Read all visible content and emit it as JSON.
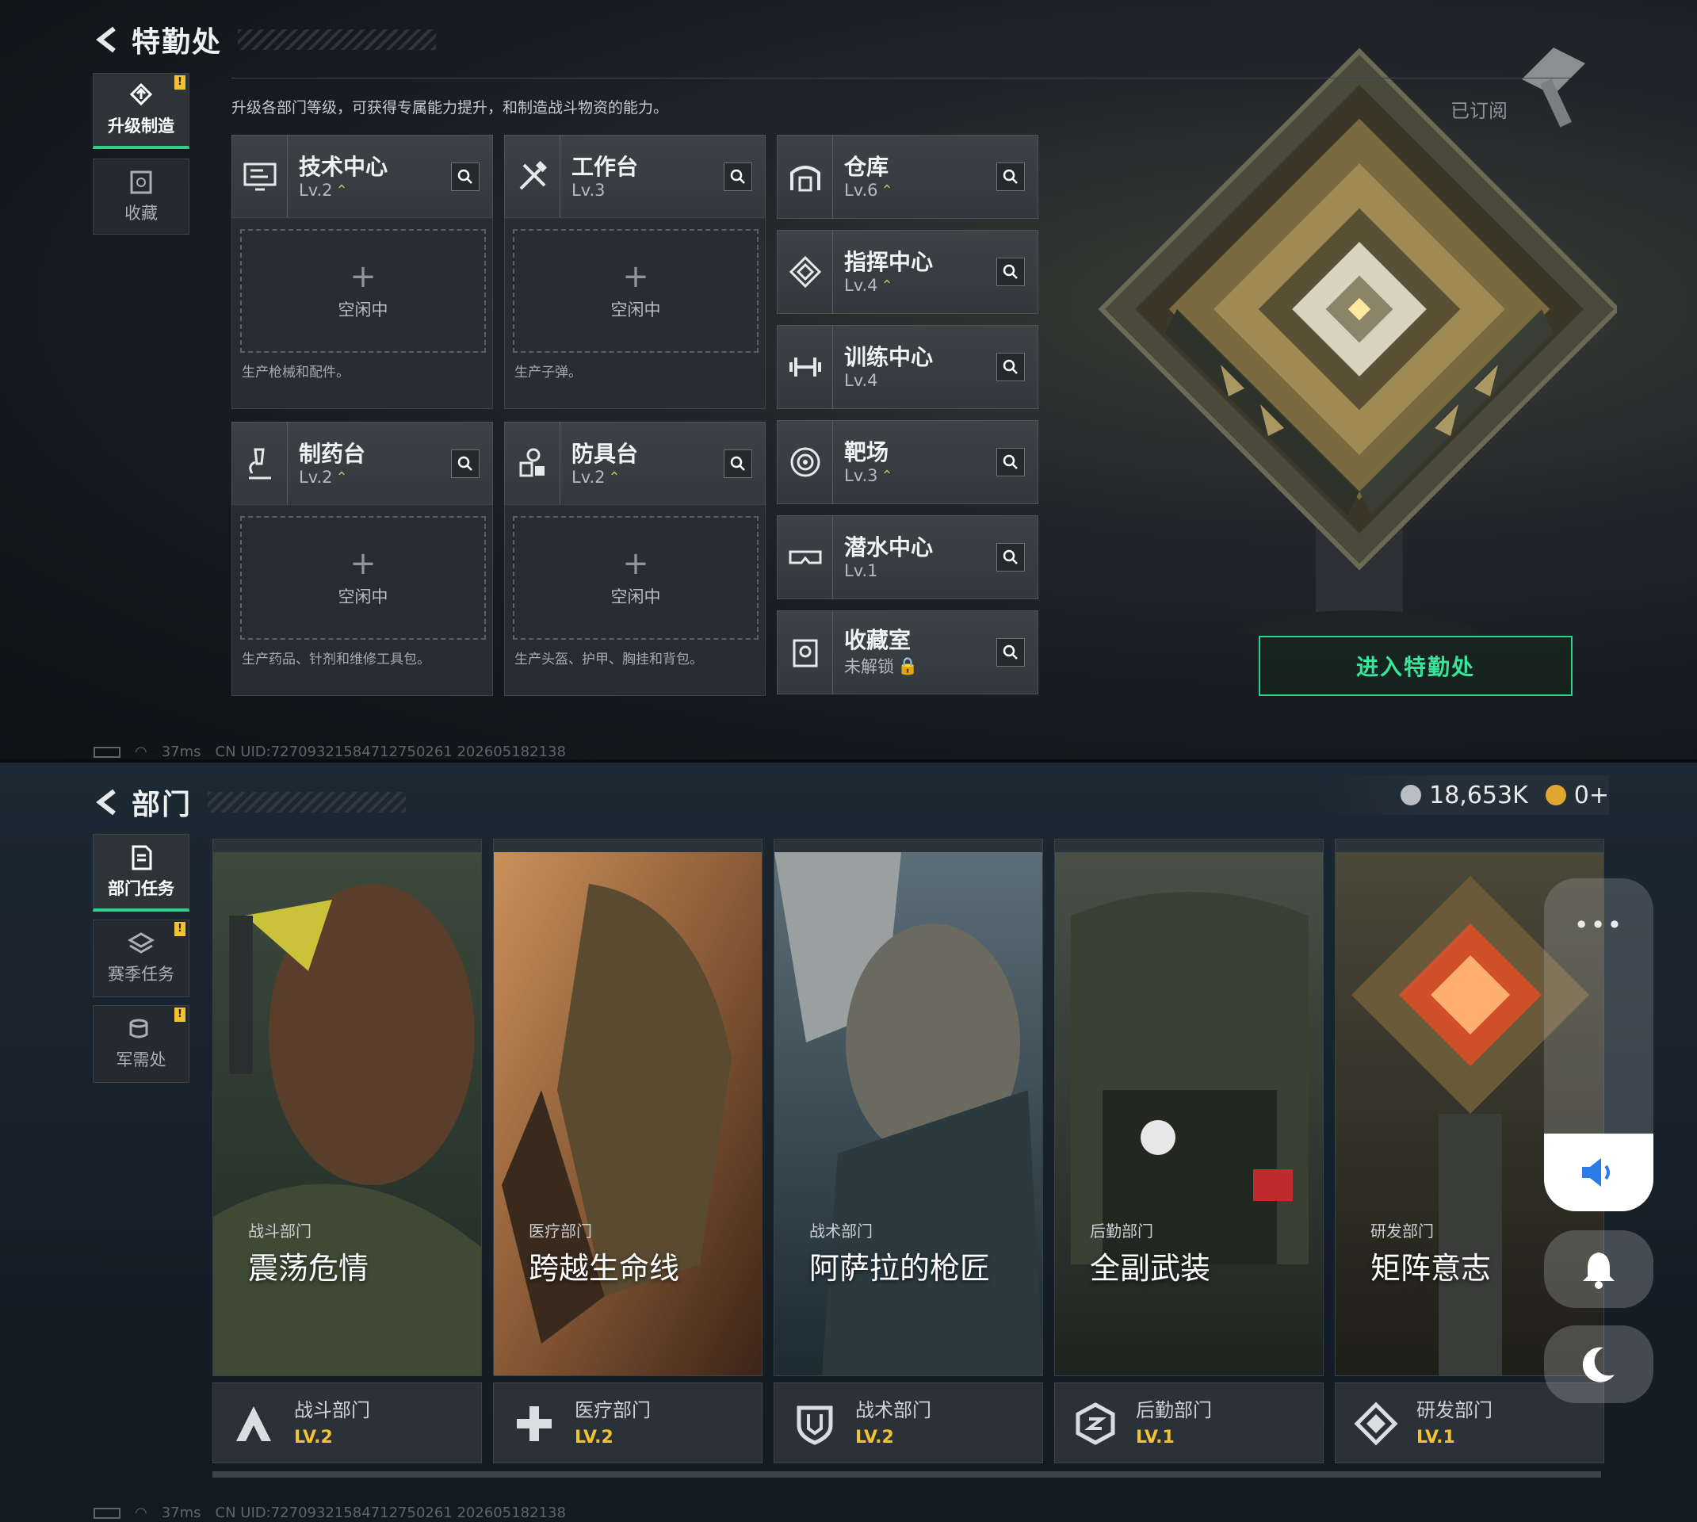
{
  "top": {
    "title": "特勤处",
    "tabs": [
      {
        "label": "升级制造",
        "active": true,
        "badge": "!"
      },
      {
        "label": "收藏",
        "active": false
      }
    ],
    "description": "升级各部门等级，可获得专属能力提升，和制造战斗物资的能力。",
    "subscribed_label": "已订阅",
    "facilities": {
      "tech_center": {
        "name": "技术中心",
        "level": "Lv.2",
        "upgradable": true,
        "icon": "monitor-icon"
      },
      "workbench": {
        "name": "工作台",
        "level": "Lv.3",
        "upgradable": false,
        "icon": "tools-icon"
      },
      "warehouse": {
        "name": "仓库",
        "level": "Lv.6",
        "upgradable": true,
        "icon": "warehouse-icon"
      },
      "command_center": {
        "name": "指挥中心",
        "level": "Lv.4",
        "upgradable": true,
        "icon": "diamond-target-icon"
      },
      "training_center": {
        "name": "训练中心",
        "level": "Lv.4",
        "upgradable": false,
        "icon": "dumbbell-icon"
      },
      "pharmacy": {
        "name": "制药台",
        "level": "Lv.2",
        "upgradable": true,
        "icon": "microscope-icon"
      },
      "armor_bench": {
        "name": "防具台",
        "level": "Lv.2",
        "upgradable": true,
        "icon": "armor-parts-icon"
      },
      "range": {
        "name": "靶场",
        "level": "Lv.3",
        "upgradable": true,
        "icon": "target-icon"
      },
      "dive_center": {
        "name": "潜水中心",
        "level": "Lv.1",
        "upgradable": false,
        "icon": "goggles-icon"
      },
      "collection_room": {
        "name": "收藏室",
        "level": "未解锁",
        "locked": true,
        "icon": "trophy-icon"
      }
    },
    "production": {
      "tech_center": {
        "status": "空闲中",
        "desc": "生产枪械和配件。"
      },
      "workbench": {
        "status": "空闲中",
        "desc": "生产子弹。"
      },
      "pharmacy": {
        "status": "空闲中",
        "desc": "生产药品、针剂和维修工具包。"
      },
      "armor_bench": {
        "status": "空闲中",
        "desc": "生产头盔、护甲、胸挂和背包。"
      }
    },
    "enter_button": "进入特勤处",
    "status": {
      "ping": "37ms",
      "uid": "CN UID:7270932158471275026​1 202605182138"
    }
  },
  "bottom": {
    "title": "部门",
    "currency": {
      "amount": "18,653K",
      "tokens": "0+"
    },
    "tabs": [
      {
        "label": "部门任务",
        "active": true
      },
      {
        "label": "赛季任务",
        "active": false,
        "badge": "!"
      },
      {
        "label": "军需处",
        "active": false,
        "badge": "!"
      }
    ],
    "departments": [
      {
        "category": "战斗部门",
        "title": "震荡危情",
        "name": "战斗部门",
        "level": "LV.2",
        "icon": "combat-a-icon"
      },
      {
        "category": "医疗部门",
        "title": "跨越生命线",
        "name": "医疗部门",
        "level": "LV.2",
        "icon": "medical-cross-icon"
      },
      {
        "category": "战术部门",
        "title": "阿萨拉的枪匠",
        "name": "战术部门",
        "level": "LV.2",
        "icon": "shield-icon"
      },
      {
        "category": "后勤部门",
        "title": "全副武装",
        "name": "后勤部门",
        "level": "LV.1",
        "icon": "logistics-hex-icon"
      },
      {
        "category": "研发部门",
        "title": "矩阵意志",
        "name": "研发部门",
        "level": "LV.1",
        "icon": "research-diamond-icon"
      }
    ],
    "status": {
      "ping": "37ms",
      "uid": "CN UID:7270932158471275026​1 202605182138"
    }
  },
  "overlay": {
    "more_label": "•••"
  }
}
